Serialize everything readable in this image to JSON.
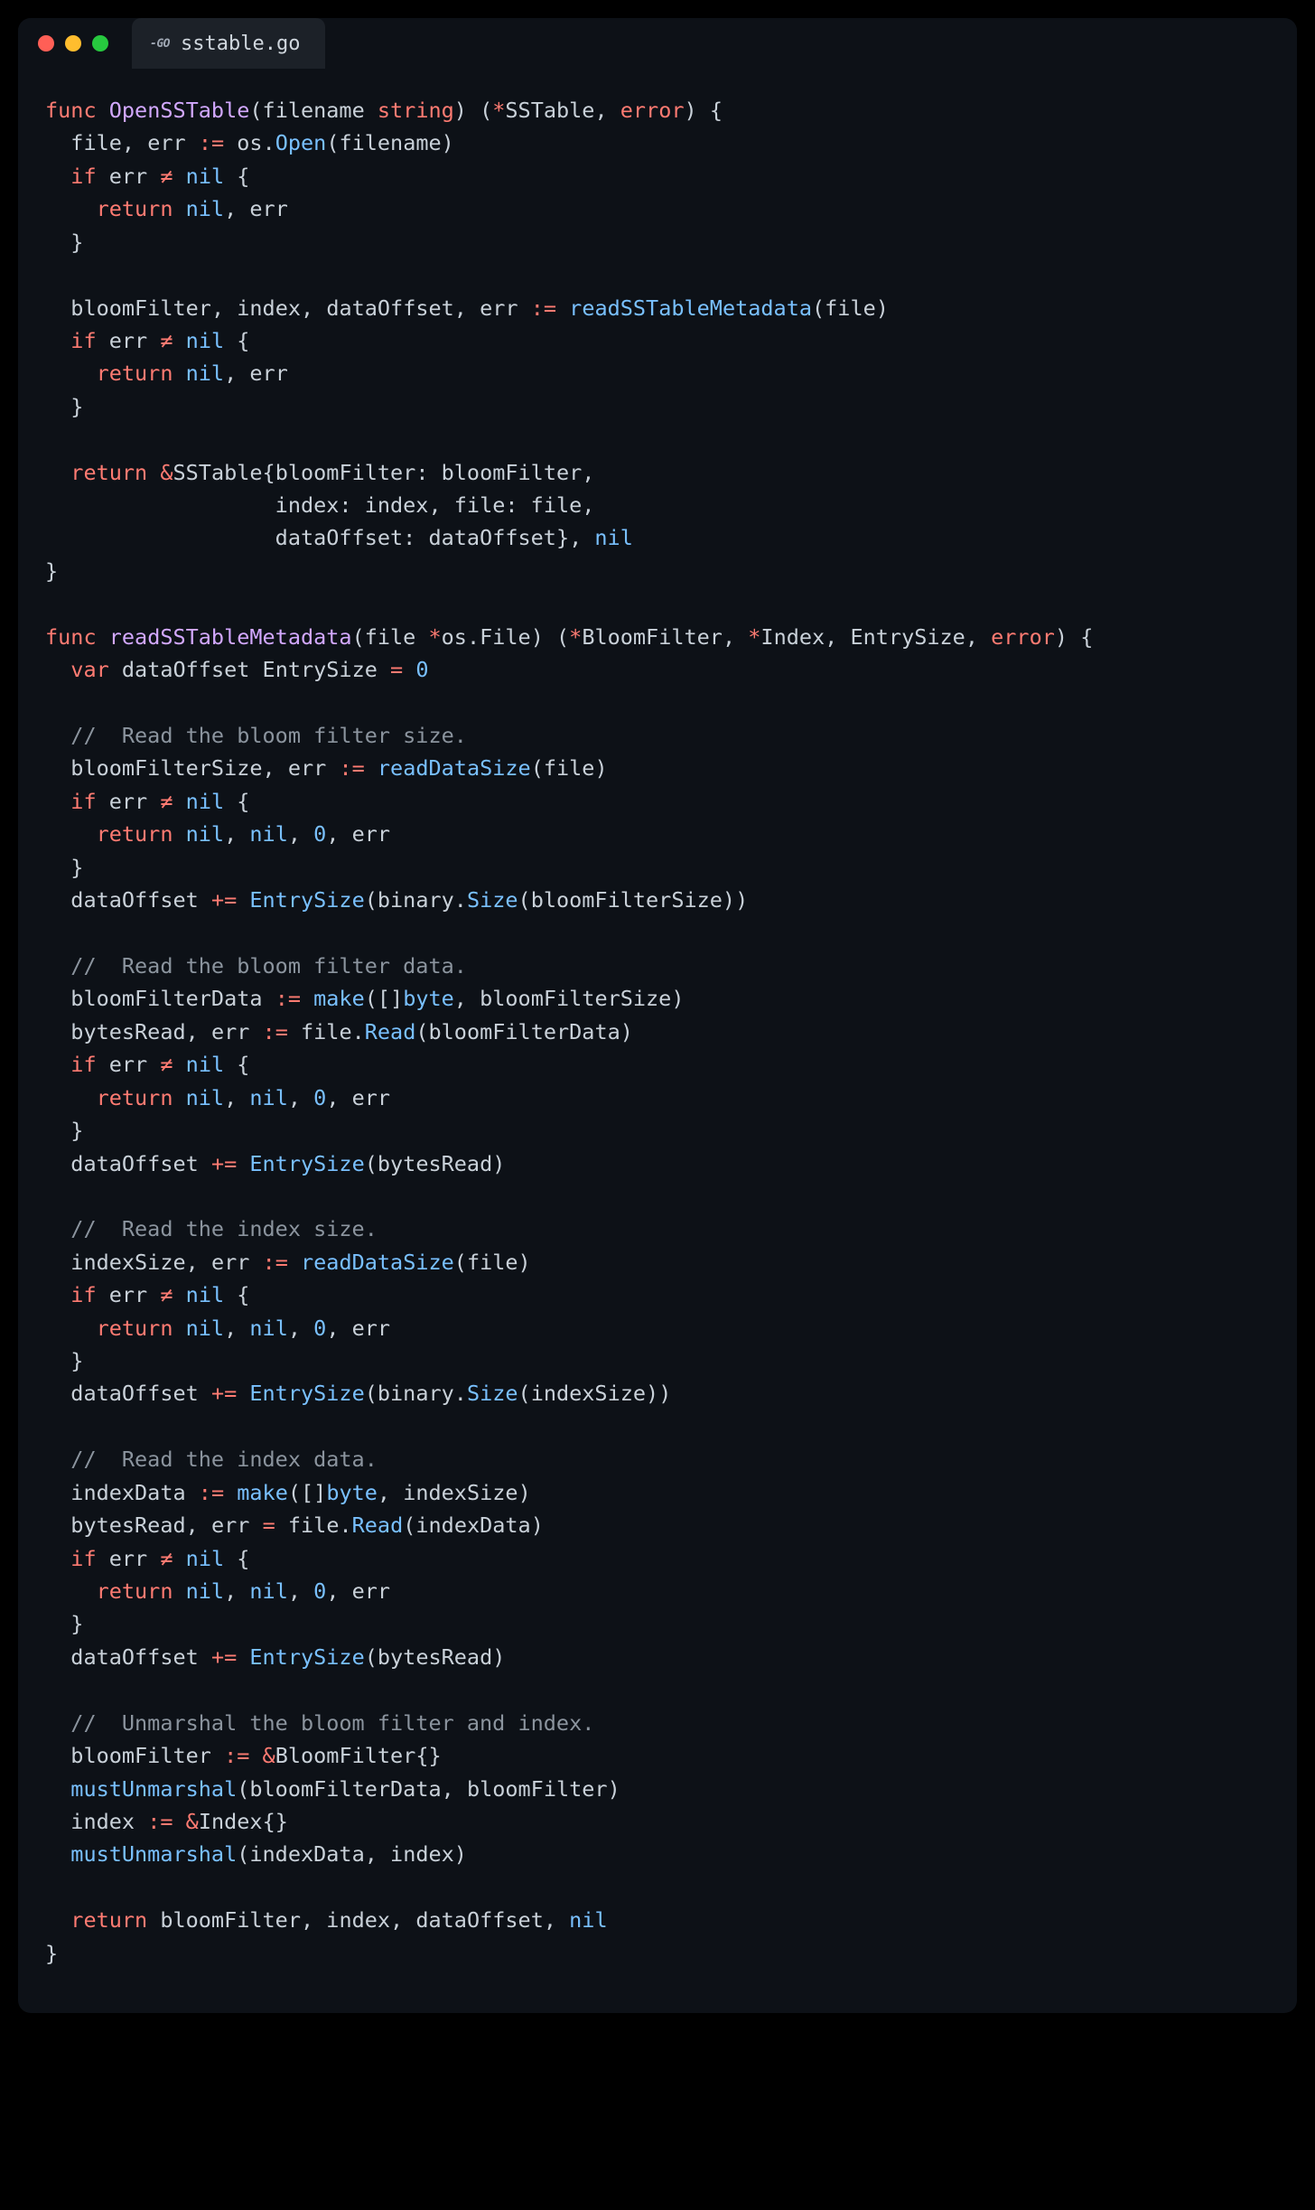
{
  "tab": {
    "icon_label": "-GO",
    "filename": "sstable.go"
  },
  "colors": {
    "bg": "#0d1117",
    "tab_bg": "#1c2128",
    "keyword": "#ff7b72",
    "func": "#d2a8ff",
    "call": "#79c0ff",
    "comment": "#8b949e",
    "traffic_red": "#ff5f56",
    "traffic_yellow": "#ffbd2e",
    "traffic_green": "#27c93f"
  },
  "tokens": {
    "func": "func",
    "if": "if",
    "return": "return",
    "var": "var",
    "nil": "nil",
    "string": "string",
    "error": "error",
    "byte": "byte",
    "ne": "≠",
    "walrus": ":=",
    "assign": "=",
    "plus_eq": "+=",
    "amp": "&",
    "star": "*",
    "zero": "0",
    "open_brace": "{",
    "close_brace": "}",
    "open_paren": "(",
    "close_paren": ")",
    "open_bracket": "[",
    "close_bracket": "]",
    "comma": ",",
    "dot": "."
  },
  "idents": {
    "OpenSSTable": "OpenSSTable",
    "readSSTableMetadata": "readSSTableMetadata",
    "filename": "filename",
    "file": "file",
    "err": "err",
    "os": "os",
    "Open": "Open",
    "bloomFilter": "bloomFilter",
    "index": "index",
    "dataOffset": "dataOffset",
    "SSTable": "SSTable",
    "BloomFilter": "BloomFilter",
    "Index": "Index",
    "EntrySize": "EntrySize",
    "File": "File",
    "bloomFilterSize": "bloomFilterSize",
    "readDataSize": "readDataSize",
    "binary": "binary",
    "Size": "Size",
    "bloomFilterData": "bloomFilterData",
    "make": "make",
    "bytesRead": "bytesRead",
    "Read": "Read",
    "indexSize": "indexSize",
    "indexData": "indexData",
    "mustUnmarshal": "mustUnmarshal"
  },
  "comments": {
    "c1": "//  Read the bloom filter size.",
    "c2": "//  Read the bloom filter data.",
    "c3": "//  Read the index size.",
    "c4": "//  Read the index data.",
    "c5": "//  Unmarshal the bloom filter and index."
  }
}
